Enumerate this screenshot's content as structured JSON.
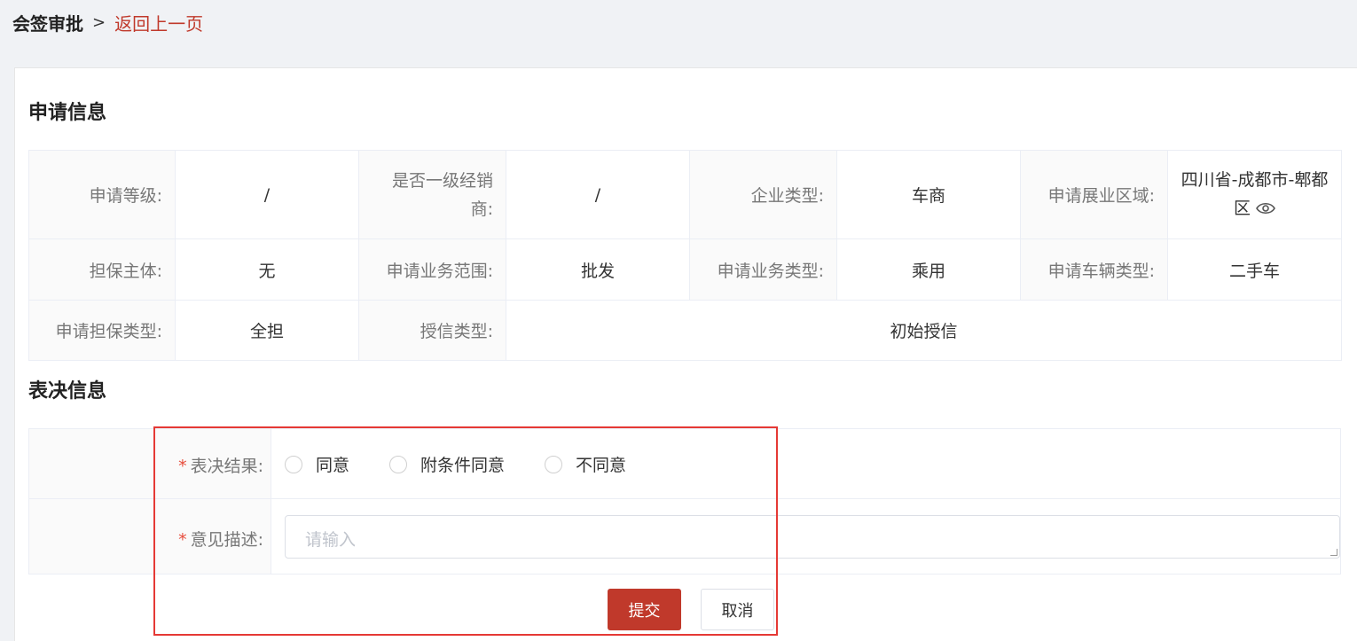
{
  "breadcrumb": {
    "current": "会签审批",
    "separator": ">",
    "back": "返回上一页"
  },
  "apply_section": {
    "title": "申请信息",
    "rows": [
      [
        {
          "label": "申请等级:",
          "value": "/"
        },
        {
          "label": "是否一级经销商:",
          "value": "/"
        },
        {
          "label": "企业类型:",
          "value": "车商"
        },
        {
          "label": "申请展业区域:",
          "value": "四川省-成都市-郫都区"
        }
      ],
      [
        {
          "label": "担保主体:",
          "value": "无"
        },
        {
          "label": "申请业务范围:",
          "value": "批发"
        },
        {
          "label": "申请业务类型:",
          "value": "乘用"
        },
        {
          "label": "申请车辆类型:",
          "value": "二手车"
        }
      ],
      [
        {
          "label": "申请担保类型:",
          "value": "全担"
        },
        {
          "label": "授信类型:",
          "value": "初始授信"
        }
      ]
    ]
  },
  "vote_section": {
    "title": "表决信息",
    "required_mark": "*",
    "result_label": "表决结果:",
    "options": [
      "同意",
      "附条件同意",
      "不同意"
    ],
    "opinion_label": "意见描述:",
    "opinion_placeholder": "请输入",
    "opinion_value": ""
  },
  "buttons": {
    "submit": "提交",
    "cancel": "取消"
  },
  "colors": {
    "accent": "#c0392b",
    "highlight": "#e53935"
  },
  "icons": {
    "area_view": "eye-icon"
  }
}
